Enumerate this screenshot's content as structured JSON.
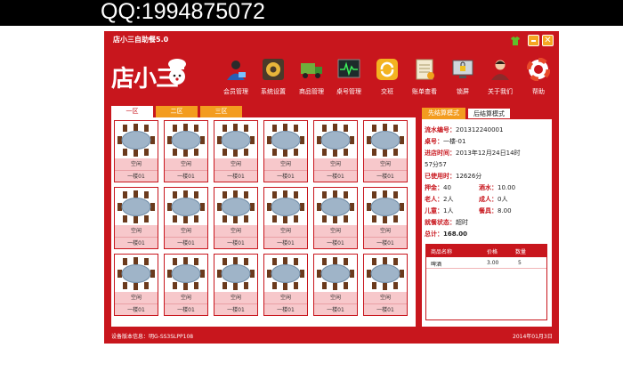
{
  "banner": {
    "qq": "QQ:1994875072"
  },
  "window": {
    "title": "店小三自助餐5.0"
  },
  "logo": {
    "text": "店小三"
  },
  "toolbar": [
    {
      "label": "会员管理",
      "icon": "member-icon",
      "color": "#2a5fb5"
    },
    {
      "label": "系统设置",
      "icon": "settings-gear-icon",
      "color": "#7a4a1a"
    },
    {
      "label": "商品管理",
      "icon": "truck-icon",
      "color": "#3d8f2f"
    },
    {
      "label": "桌号管理",
      "icon": "monitor-icon",
      "color": "#1f2a2a"
    },
    {
      "label": "交班",
      "icon": "refresh-icon",
      "color": "#f0a21c"
    },
    {
      "label": "账单查看",
      "icon": "bill-icon",
      "color": "#d9c98b"
    },
    {
      "label": "锁屏",
      "icon": "lock-screen-icon",
      "color": "#3a3a3a"
    },
    {
      "label": "关于我们",
      "icon": "user-icon",
      "color": "#8c2a2a"
    },
    {
      "label": "帮助",
      "icon": "lifebuoy-icon",
      "color": "#e84a2a"
    }
  ],
  "zones": [
    "一区",
    "二区",
    "三区"
  ],
  "tables": [
    {
      "status": "空闲",
      "name": "一楼01"
    },
    {
      "status": "空闲",
      "name": "一楼01"
    },
    {
      "status": "空闲",
      "name": "一楼01"
    },
    {
      "status": "空闲",
      "name": "一楼01"
    },
    {
      "status": "空闲",
      "name": "一楼01"
    },
    {
      "status": "空闲",
      "name": "一楼01"
    },
    {
      "status": "空闲",
      "name": "一楼01"
    },
    {
      "status": "空闲",
      "name": "一楼01"
    },
    {
      "status": "空闲",
      "name": "一楼01"
    },
    {
      "status": "空闲",
      "name": "一楼01"
    },
    {
      "status": "空闲",
      "name": "一楼01"
    },
    {
      "status": "空闲",
      "name": "一楼01"
    },
    {
      "status": "空闲",
      "name": "一楼01"
    },
    {
      "status": "空闲",
      "name": "一楼01"
    },
    {
      "status": "空闲",
      "name": "一楼01"
    },
    {
      "status": "空闲",
      "name": "一楼01"
    },
    {
      "status": "空闲",
      "name": "一楼01"
    },
    {
      "status": "空闲",
      "name": "一楼01"
    }
  ],
  "modes": {
    "prepay": "先结算模式",
    "postpay": "后结算模式"
  },
  "info": {
    "serial_k": "流水编号：",
    "serial_v": "201312240001",
    "table_k": "桌号：",
    "table_v": "一楼-01",
    "time_k": "进店时间：",
    "time_v": "2013年12月24日14时",
    "time_v2": "57分57",
    "used_k": "已使用时：",
    "used_v": "12626分",
    "deposit_k": "押金：",
    "deposit_v": "40",
    "wine_k": "酒水：",
    "wine_v": "10.00",
    "elder_k": "老人：",
    "elder_v": "2人",
    "adult_k": "成人：",
    "adult_v": "0人",
    "child_k": "儿童：",
    "child_v": "1人",
    "meal_k": "餐具：",
    "meal_v": "8.00",
    "state_k": "就餐状态：",
    "state_v": "超时",
    "total_k": "总计：",
    "total_v": "168.00"
  },
  "goods": {
    "headers": [
      "商品名称",
      "价格",
      "数量"
    ],
    "rows": [
      {
        "name": "啤酒",
        "price": "3.00",
        "qty": "5"
      }
    ]
  },
  "status": {
    "left": "设备版本信息：明G-SS3SLPP108",
    "right": "2014年01月3日"
  },
  "colors": {
    "window_red": "#c8161d",
    "zone_orange": "#f39c1f",
    "card_pink": "#f7c8cb"
  }
}
